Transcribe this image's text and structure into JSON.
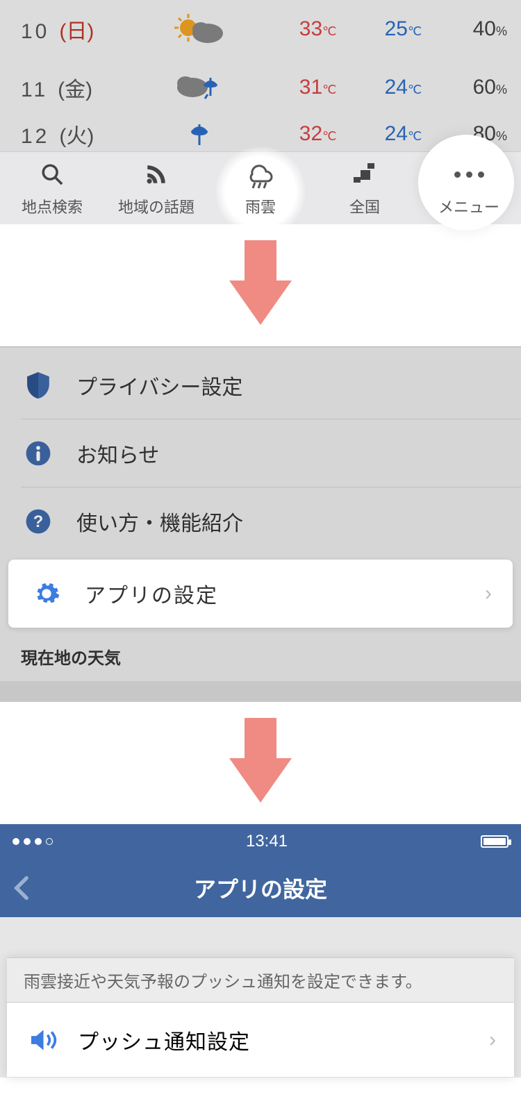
{
  "forecast": [
    {
      "day": "10",
      "weekday": "(日)",
      "weekday_class": "sun",
      "weather": "sun-cloud",
      "hi": "33",
      "lo": "25",
      "pr": "40"
    },
    {
      "day": "11",
      "weekday": "(金)",
      "weekday_class": "",
      "weather": "cloud-rain",
      "hi": "31",
      "lo": "24",
      "pr": "60"
    },
    {
      "day": "12",
      "weekday": "(火)",
      "weekday_class": "",
      "weather": "rain",
      "hi": "32",
      "lo": "24",
      "pr": "80"
    }
  ],
  "units": {
    "temp": "℃",
    "precip": "%"
  },
  "tabs": {
    "search": "地点検索",
    "local": "地域の話題",
    "rain": "雨雲",
    "nation": "全国",
    "menu": "メニュー"
  },
  "menu_panel": {
    "privacy": "プライバシー設定",
    "notice": "お知らせ",
    "howto": "使い方・機能紹介",
    "appsettings": "アプリの設定",
    "section_label": "現在地の天気"
  },
  "settings_panel": {
    "time": "13:41",
    "title": "アプリの設定",
    "note": "雨雲接近や天気予報のプッシュ通知を設定できます。",
    "push": "プッシュ通知設定"
  }
}
